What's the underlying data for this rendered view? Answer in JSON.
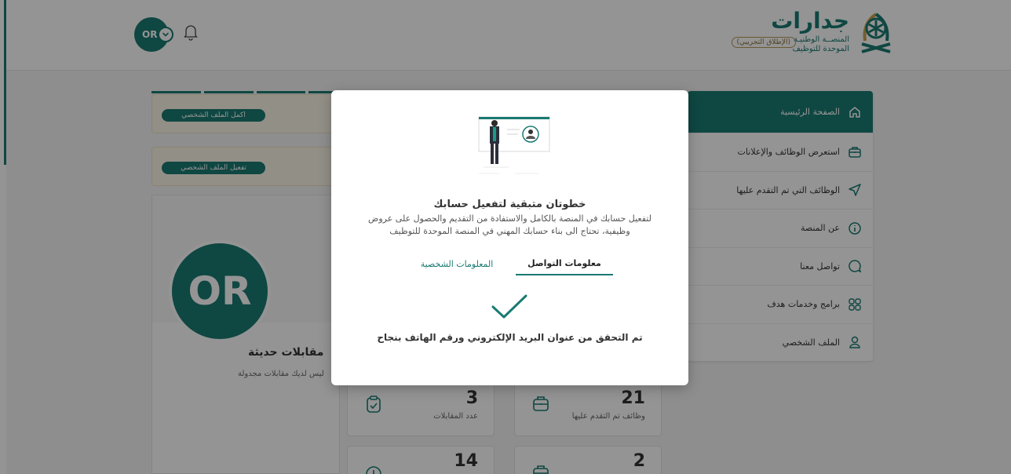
{
  "header": {
    "user_initials": "OR",
    "logo": {
      "title": "جدارات",
      "subtitle_line1": "المنصــة الوطنيـة",
      "subtitle_line2": "الموحدة للتوظيف",
      "beta_badge": "(الإطلاق التجريبي)"
    }
  },
  "sidebar": {
    "items": [
      {
        "label": "الصفحة الرئيسية",
        "icon": "home-icon",
        "active": true
      },
      {
        "label": "استعرض الوظائف والإعلانات",
        "icon": "briefcase-icon",
        "active": false
      },
      {
        "label": "الوظائف التي تم التقدم عليها",
        "icon": "send-icon",
        "active": false
      },
      {
        "label": "عن المنصة",
        "icon": "info-icon",
        "active": false
      },
      {
        "label": "تواصل معنا",
        "icon": "chat-icon",
        "active": false
      },
      {
        "label": "برامج وخدمات هدف",
        "icon": "grid-icon",
        "active": false
      },
      {
        "label": "الملف الشخصي",
        "icon": "user-icon",
        "active": false
      }
    ]
  },
  "notices": {
    "complete_profile": "اكمل الملف الشخصي",
    "activate_profile": "تفعيل الملف الشخصي"
  },
  "profile": {
    "initials": "OR",
    "interviews_title": "مقابلات حديثة",
    "interviews_empty": "ليس لديك مقابلات مجدولة"
  },
  "stats": [
    {
      "value": "21",
      "label": "وظائف تم التقدم عليها",
      "icon": "briefcase-icon"
    },
    {
      "value": "3",
      "label": "عدد المقابلات",
      "icon": "clipboard-icon"
    },
    {
      "value": "2",
      "label": "",
      "icon": "briefcase-icon"
    },
    {
      "value": "14",
      "label": "",
      "icon": "clock-icon"
    }
  ],
  "modal": {
    "title": "خطوتان متبقية لتفعيل حسابك",
    "description": "لتفعيل حسابك في المنصة بالكامل والاستفادة من التقديم والحصول على عروض وظيفية، تحتاج الى بناء حسابك المهني في المنصة الموحدة للتوظيف",
    "tabs": {
      "contact": "معلومات التواصل",
      "personal": "المعلومات الشخصية"
    },
    "success_message": "تم التحقق من عنوان البريد الإلكتروني ورقم الهاتف بنجاح"
  },
  "colors": {
    "brand": "#1a7a72",
    "overlay": "rgba(0,0,0,0.42)",
    "notice_bg": "#fbf6e8"
  }
}
